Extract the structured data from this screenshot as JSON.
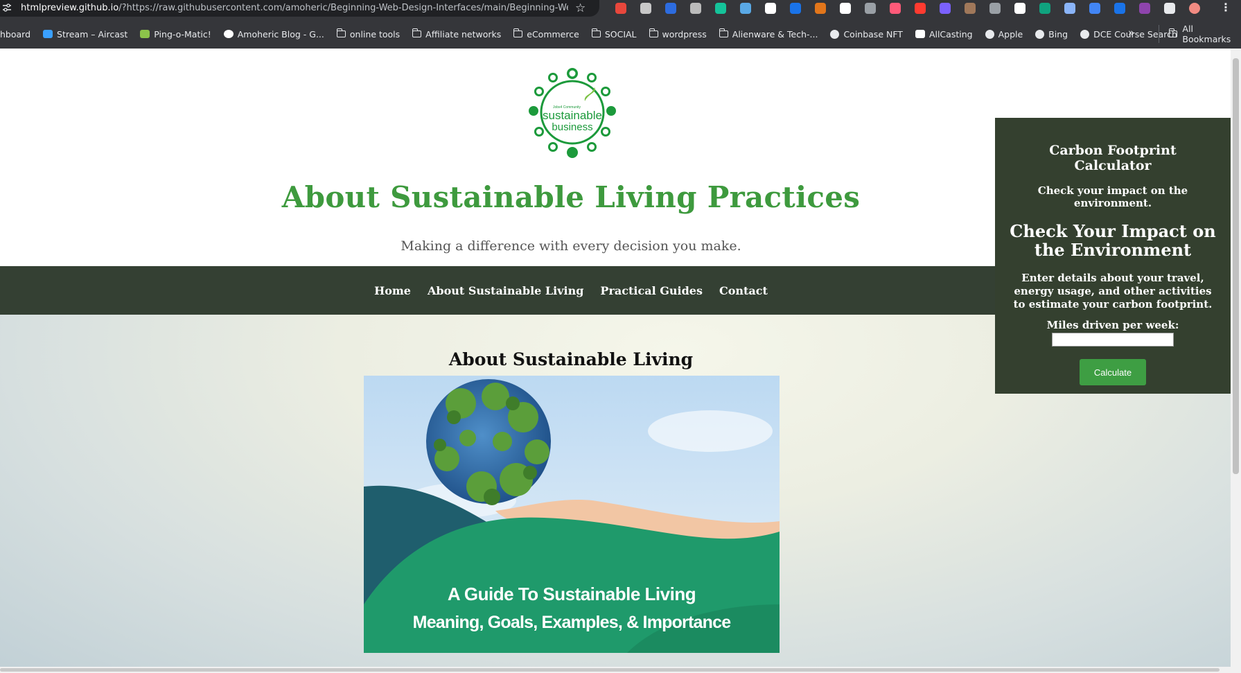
{
  "browser": {
    "url_host": "htmlpreview.github.io",
    "url_rest": "/?https://raw.githubusercontent.com/amoheric/Beginning-Web-Design-Interfaces/main/Beginning-Web-...",
    "extensions": [
      {
        "name": "k-ext",
        "color": "#e8473c"
      },
      {
        "name": "openai-ext",
        "color": "#c8c8c8"
      },
      {
        "name": "k-blue-ext",
        "color": "#2d6cdf"
      },
      {
        "name": "cube-ext",
        "color": "#bbbbbb"
      },
      {
        "name": "grammarly-ext",
        "color": "#15c39a"
      },
      {
        "name": "heart-ext",
        "color": "#5aa9e6"
      },
      {
        "name": "play-ext",
        "color": "#ffffff"
      },
      {
        "name": "circle-blue-ext",
        "color": "#1a73e8"
      },
      {
        "name": "fox-ext",
        "color": "#e2761b"
      },
      {
        "name": "n-ext",
        "color": "#ffffff"
      },
      {
        "name": "img-ext",
        "color": "#9aa0a6"
      },
      {
        "name": "camera-ext",
        "color": "#ff5a79"
      },
      {
        "name": "ball-ext",
        "color": "#ff3b30"
      },
      {
        "name": "bracket-ext",
        "color": "#7b61ff"
      },
      {
        "name": "photo-ext",
        "color": "#a0785a"
      },
      {
        "name": "eye-ext",
        "color": "#9aa0a6"
      },
      {
        "name": "lock-ext",
        "color": "#ffffff"
      },
      {
        "name": "green-circle-ext",
        "color": "#10a37f"
      },
      {
        "name": "wave-ext",
        "color": "#8ab4f8"
      },
      {
        "name": "tag-ext",
        "color": "#4285f4"
      },
      {
        "name": "screen-ext",
        "color": "#1a73e8"
      },
      {
        "name": "square-ext",
        "color": "#8e44ad"
      },
      {
        "name": "puzzle-ext",
        "color": "#e8eaed"
      },
      {
        "name": "profile-ext",
        "color": "#f28b82"
      }
    ],
    "bookmarks": [
      {
        "label": "hboard",
        "icon": "none"
      },
      {
        "label": "Stream – Aircast",
        "icon": "aircast"
      },
      {
        "label": "Ping-o-Matic!",
        "icon": "leaf"
      },
      {
        "label": "Amoheric Blog - G...",
        "icon": "google"
      },
      {
        "label": "online tools",
        "icon": "folder"
      },
      {
        "label": "Affiliate networks",
        "icon": "folder"
      },
      {
        "label": "eCommerce",
        "icon": "folder"
      },
      {
        "label": "SOCIAL",
        "icon": "folder"
      },
      {
        "label": "wordpress",
        "icon": "folder"
      },
      {
        "label": "Alienware & Tech-...",
        "icon": "folder"
      },
      {
        "label": "Coinbase NFT",
        "icon": "globe"
      },
      {
        "label": "AllCasting",
        "icon": "allcasting"
      },
      {
        "label": "Apple",
        "icon": "globe"
      },
      {
        "label": "Bing",
        "icon": "globe"
      },
      {
        "label": "DCE Course Search",
        "icon": "globe"
      }
    ],
    "more_bookmarks": "»",
    "all_bookmarks": "All Bookmarks"
  },
  "site": {
    "logo_text_line1": "sustainable",
    "logo_text_line2": "business",
    "logo_small_text": "Jobs4 Community",
    "title": "About Sustainable Living Practices",
    "tagline": "Making a difference with every decision you make.",
    "nav": [
      "Home",
      "About Sustainable Living",
      "Practical Guides",
      "Contact"
    ]
  },
  "main": {
    "section_title": "About Sustainable Living",
    "hero_line1": "A Guide To Sustainable Living",
    "hero_line2": "Meaning, Goals, Examples, & Importance"
  },
  "calculator": {
    "heading": "Carbon Footprint Calculator",
    "subheading": "Check your impact on the environment.",
    "title": "Check Your Impact on the Environment",
    "description": "Enter details about your travel, energy usage, and other activities to estimate your carbon footprint.",
    "miles_label": "Miles driven per week:",
    "miles_value": "",
    "button": "Calculate"
  },
  "colors": {
    "accent_green": "#3e9a3e",
    "nav_bg": "#344033",
    "button_green": "#3e9e43"
  }
}
